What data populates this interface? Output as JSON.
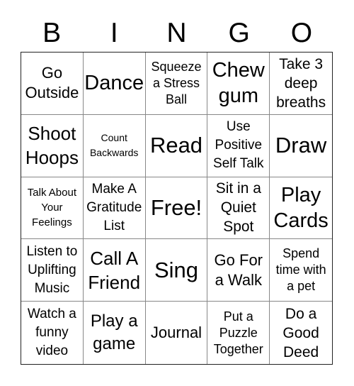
{
  "title_letters": [
    "B",
    "I",
    "N",
    "G",
    "O"
  ],
  "rows": [
    [
      "Go Outside",
      "Dance",
      "Squeeze a Stress Ball",
      "Chew gum",
      "Take 3 deep breaths"
    ],
    [
      "Shoot Hoops",
      "Count Backwards",
      "Read",
      "Use Positive Self Talk",
      "Draw"
    ],
    [
      "Talk About Your Feelings",
      "Make A Gratitude List",
      "Free!",
      "Sit in a Quiet Spot",
      "Play Cards"
    ],
    [
      "Listen to Uplifting Music",
      "Call A Friend",
      "Sing",
      "Go For a Walk",
      "Spend time with a pet"
    ],
    [
      "Watch a funny video",
      "Play a game",
      "Journal",
      "Put a Puzzle Together",
      "Do a Good Deed"
    ]
  ],
  "colors": {
    "grid_outer": "#222222",
    "grid_inner": "#888888",
    "text": "#000000",
    "background": "#ffffff"
  }
}
